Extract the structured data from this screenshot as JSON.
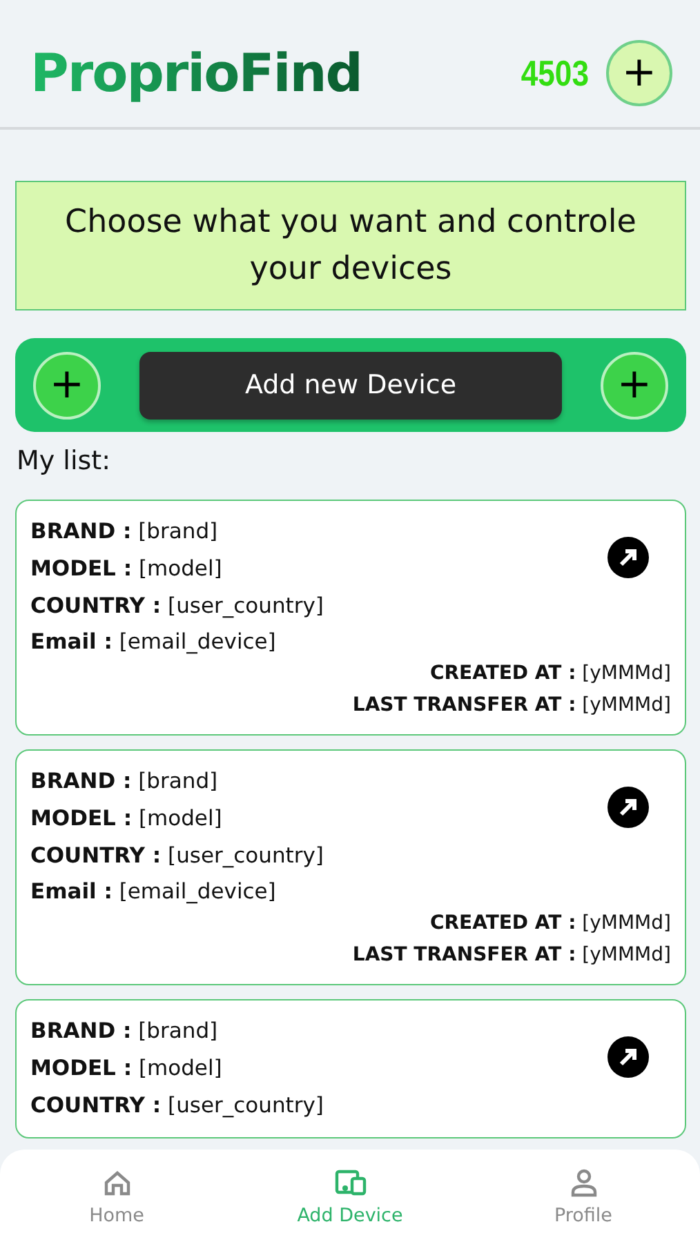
{
  "header": {
    "title": "ProprioFind",
    "points": "4503",
    "add_button": "+"
  },
  "banner": {
    "text": "Choose what you want and controle your devices"
  },
  "actions": {
    "left_button": "+",
    "main_button": "Add new Device",
    "right_button": "+"
  },
  "list_title": "My list:",
  "devices": [
    {
      "fields": [
        "**BRAND :** [brand]",
        "**MODEL :** [model]",
        "**COUNTRY :** [user_country]",
        "**Email :** [email_device]"
      ],
      "dates": [
        "**CREATED AT :** [yMMMd]",
        "**LAST TRANSFER AT :** [yMMMd]"
      ]
    },
    {
      "fields": [
        "**BRAND :** [brand]",
        "**MODEL :** [model]",
        "**COUNTRY :** [user_country]",
        "**Email :** [email_device]"
      ],
      "dates": [
        "**CREATED AT :** [yMMMd]",
        "**LAST TRANSFER AT :** [yMMMd]"
      ]
    },
    {
      "fields": [
        "**BRAND :** [brand]",
        "**MODEL :** [model]",
        "**COUNTRY :** [user_country]"
      ]
    }
  ],
  "nav": [
    {
      "kind": "home",
      "label": "Home",
      "selected": false
    },
    {
      "kind": "device",
      "label": "Add Device",
      "selected": true
    },
    {
      "kind": "profile",
      "label": "Profile",
      "selected": false
    }
  ]
}
